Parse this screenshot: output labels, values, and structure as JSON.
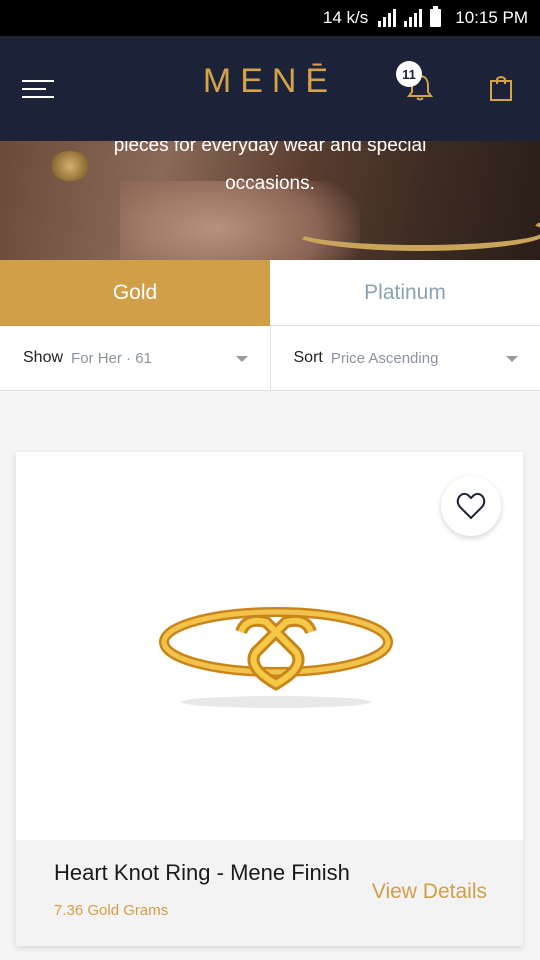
{
  "status_bar": {
    "speed": "14 k/s",
    "network": "H+",
    "time": "10:15 PM"
  },
  "nav": {
    "logo": "MENĒ",
    "notifications_count": "11"
  },
  "hero": {
    "text_line1": "pieces for everyday wear and special",
    "text_line2": "occasions."
  },
  "tabs": [
    {
      "label": "Gold",
      "active": true
    },
    {
      "label": "Platinum",
      "active": false
    }
  ],
  "filters": {
    "show": {
      "label": "Show",
      "value": "For Her · 61"
    },
    "sort": {
      "label": "Sort",
      "value": "Price Ascending"
    }
  },
  "product": {
    "name": "Heart Knot Ring - Mene Finish",
    "weight": "7.36 Gold Grams",
    "cta": "View Details"
  },
  "colors": {
    "navy": "#1c2338",
    "gold": "#d19f48",
    "platinum_text": "#8aa3b3"
  },
  "icons": [
    "menu-icon",
    "bell-icon",
    "shopping-bag-icon",
    "heart-icon",
    "chevron-down-icon"
  ]
}
